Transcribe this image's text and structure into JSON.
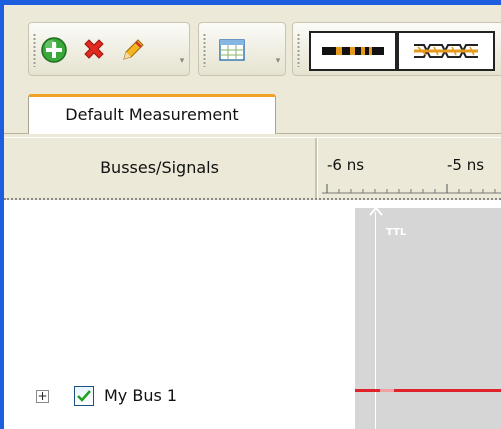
{
  "toolbar": {
    "groups": [
      {
        "name": "edit-group",
        "buttons": [
          {
            "icon": "add-icon",
            "tooltip": ""
          },
          {
            "icon": "delete-icon",
            "tooltip": ""
          },
          {
            "icon": "edit-pencil-icon",
            "tooltip": ""
          }
        ]
      },
      {
        "name": "view-group",
        "buttons": [
          {
            "icon": "table-icon",
            "tooltip": ""
          }
        ]
      },
      {
        "name": "waveform-group",
        "buttons": [
          {
            "icon": "timing-waveform-icon",
            "tooltip": ""
          },
          {
            "icon": "eye-diagram-icon",
            "tooltip": ""
          }
        ]
      }
    ]
  },
  "tabs": [
    {
      "label": "Default Measurement",
      "selected": true
    }
  ],
  "header": {
    "busses_label": "Busses/Signals",
    "time_ticks": [
      "-6 ns",
      "-5 ns"
    ]
  },
  "waveform": {
    "cursor_label": "TTL",
    "signal_color": "#e0232a",
    "pane_color": "#d6d6d6"
  },
  "signals": [
    {
      "name": "My Bus 1",
      "checked": true,
      "expanded": false
    }
  ],
  "colors": {
    "frame": "#1c5ede",
    "tab_accent": "#f0a126",
    "toolbar_bg": "#ece9d8"
  }
}
